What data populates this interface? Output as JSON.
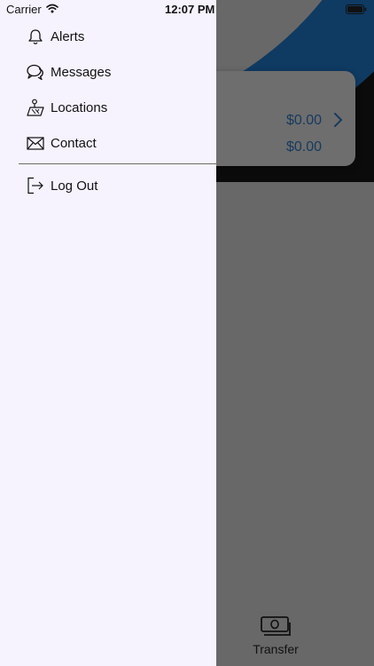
{
  "status_bar": {
    "carrier": "Carrier",
    "time": "12:07 PM"
  },
  "drawer": {
    "items": [
      {
        "label": "Alerts",
        "icon": "bell-icon"
      },
      {
        "label": "Messages",
        "icon": "chat-bubbles-icon"
      },
      {
        "label": "Locations",
        "icon": "map-pin-icon"
      },
      {
        "label": "Contact",
        "icon": "envelope-icon"
      }
    ],
    "logout": {
      "label": "Log Out",
      "icon": "logout-icon"
    },
    "background_color": "#f6f3ff"
  },
  "background_app": {
    "balances": [
      "$0.00",
      "$0.00"
    ],
    "tab": {
      "label": "Transfer",
      "icon": "cash-transfer-icon"
    },
    "accent_color": "#163a5e"
  }
}
